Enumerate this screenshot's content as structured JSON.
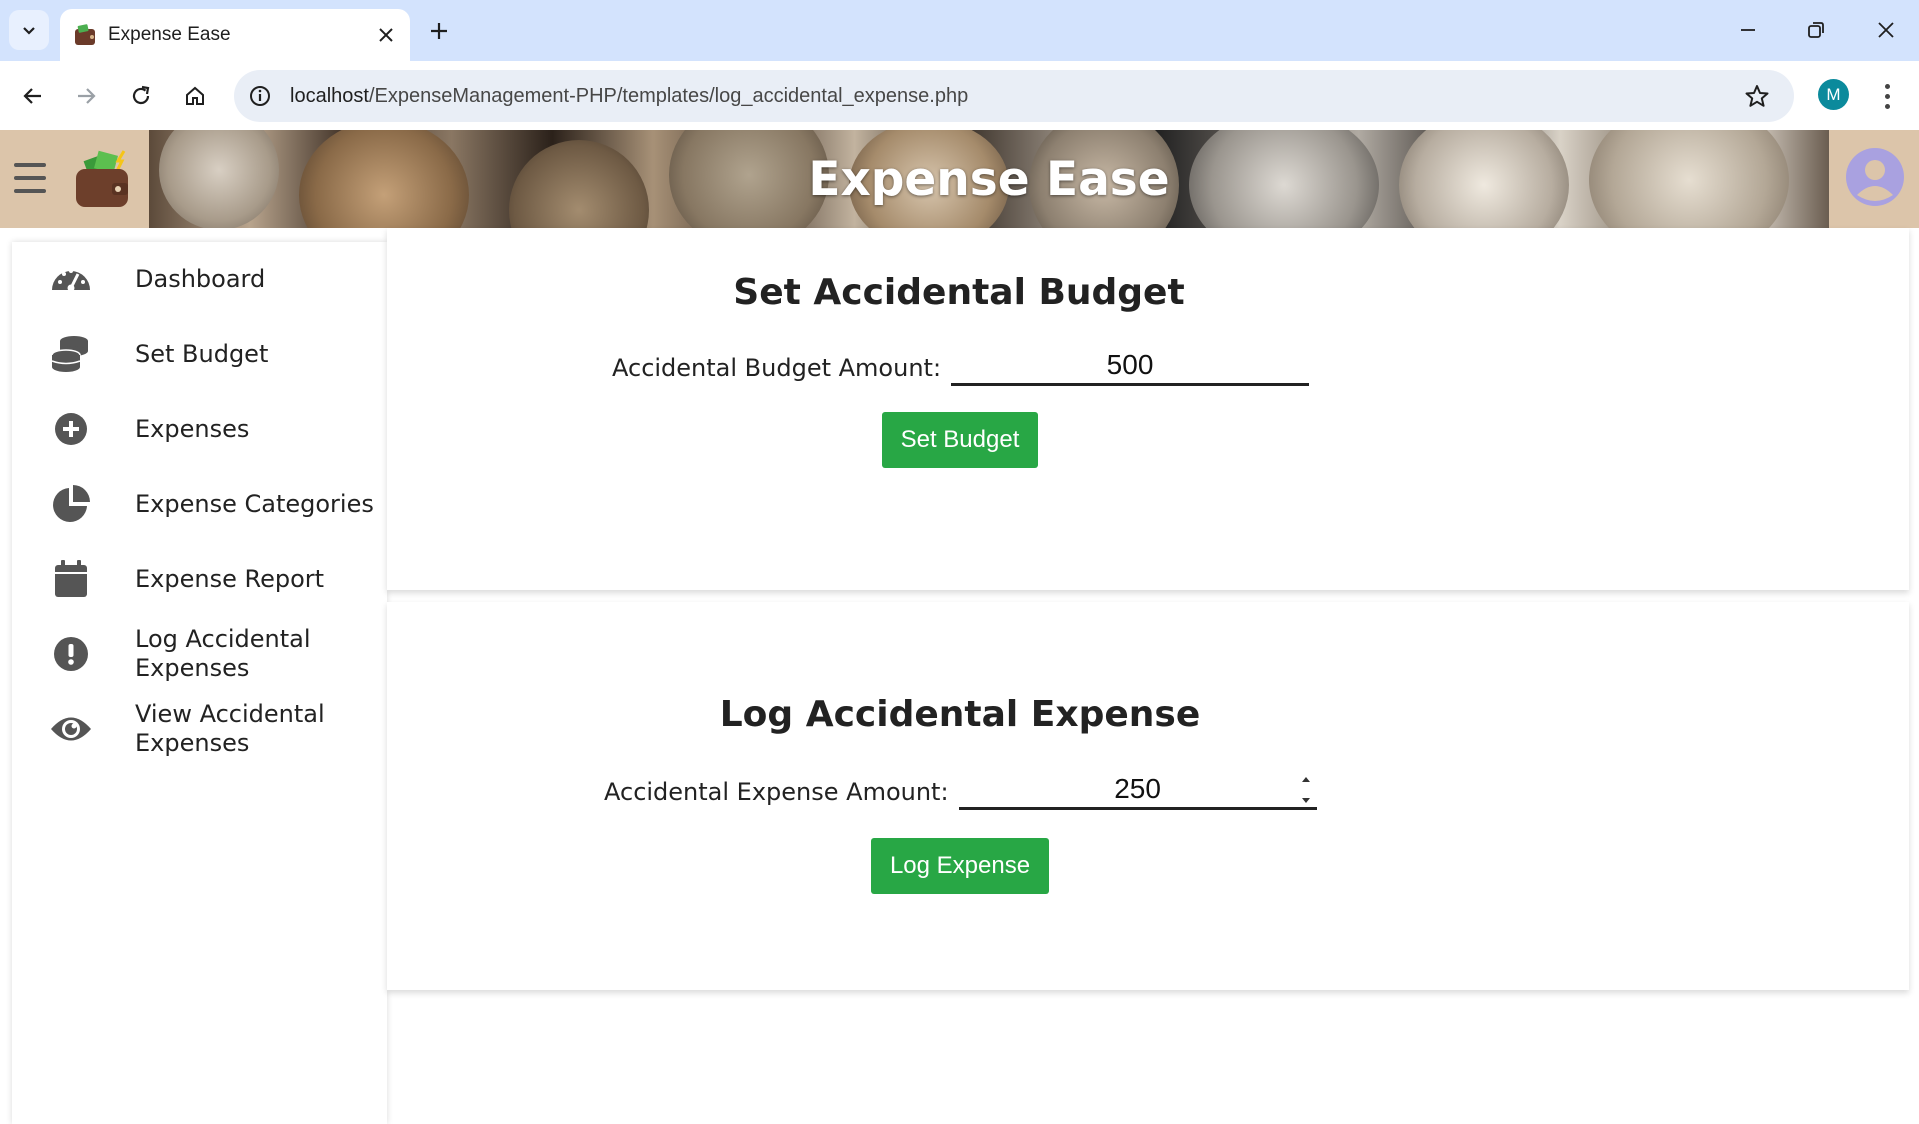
{
  "browser": {
    "tab_title": "Expense Ease",
    "url_host": "localhost",
    "url_path": "/ExpenseManagement-PHP/templates/log_accidental_expense.php",
    "profile_initial": "M"
  },
  "header": {
    "title": "Expense Ease"
  },
  "sidebar": {
    "items": [
      {
        "label": "Dashboard",
        "icon": "gauge-icon"
      },
      {
        "label": "Set Budget",
        "icon": "coins-icon"
      },
      {
        "label": "Expenses",
        "icon": "plus-circle-icon"
      },
      {
        "label": "Expense Categories",
        "icon": "pie-chart-icon"
      },
      {
        "label": "Expense Report",
        "icon": "calendar-icon"
      },
      {
        "label": "Log Accidental Expenses",
        "icon": "exclamation-circle-icon"
      },
      {
        "label": "View Accidental Expenses",
        "icon": "eye-icon"
      }
    ]
  },
  "budget_form": {
    "title": "Set Accidental Budget",
    "label": "Accidental Budget Amount:",
    "value": "500",
    "button": "Set Budget"
  },
  "expense_form": {
    "title": "Log Accidental Expense",
    "label": "Accidental Expense Amount:",
    "value": "250",
    "button": "Log Expense"
  },
  "colors": {
    "accent_green": "#28a745",
    "tabbar": "#d3e3fd",
    "header_bg": "#dcc5aa"
  }
}
